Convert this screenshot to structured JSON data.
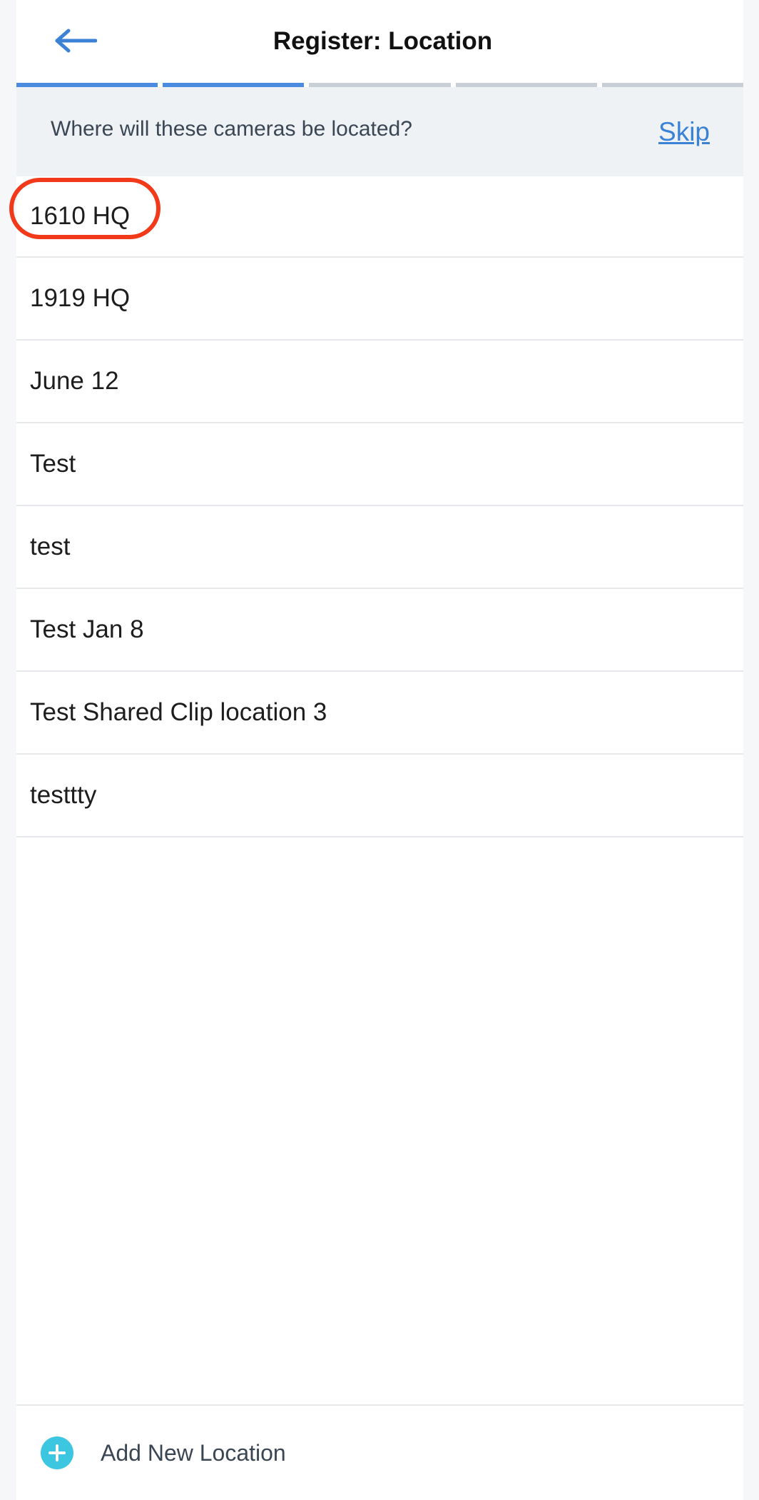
{
  "header": {
    "title": "Register: Location",
    "back_icon": "arrow-left-icon"
  },
  "progress": {
    "total_steps": 5,
    "completed_steps": 2,
    "accent_color": "#4a8be0",
    "inactive_color": "#c9cfd6"
  },
  "prompt": {
    "text": "Where will these cameras be located?",
    "skip_label": "Skip"
  },
  "locations": [
    {
      "label": "1610 HQ",
      "highlighted": true
    },
    {
      "label": "1919 HQ"
    },
    {
      "label": "June 12"
    },
    {
      "label": "Test"
    },
    {
      "label": "test"
    },
    {
      "label": "Test Jan 8"
    },
    {
      "label": "Test Shared Clip location 3"
    },
    {
      "label": "testtty"
    }
  ],
  "footer": {
    "add_label": "Add New Location",
    "add_icon": "plus-circle-icon",
    "icon_color": "#3cc6e0"
  },
  "annotation": {
    "ring_color": "#f23a1b"
  }
}
